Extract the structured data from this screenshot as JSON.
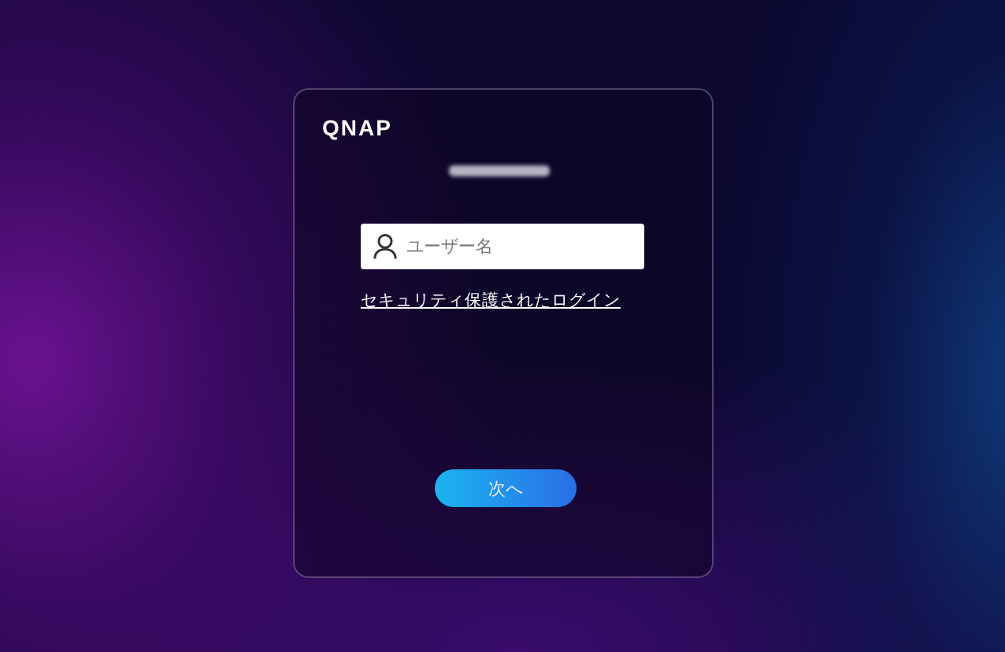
{
  "logo": {
    "text": "QNAP"
  },
  "device_name": {
    "kind": "redacted"
  },
  "username_field": {
    "placeholder": "ユーザー名"
  },
  "secure_login_link": {
    "label": "セキュリティ保護されたログイン"
  },
  "next_button": {
    "label": "次へ"
  }
}
